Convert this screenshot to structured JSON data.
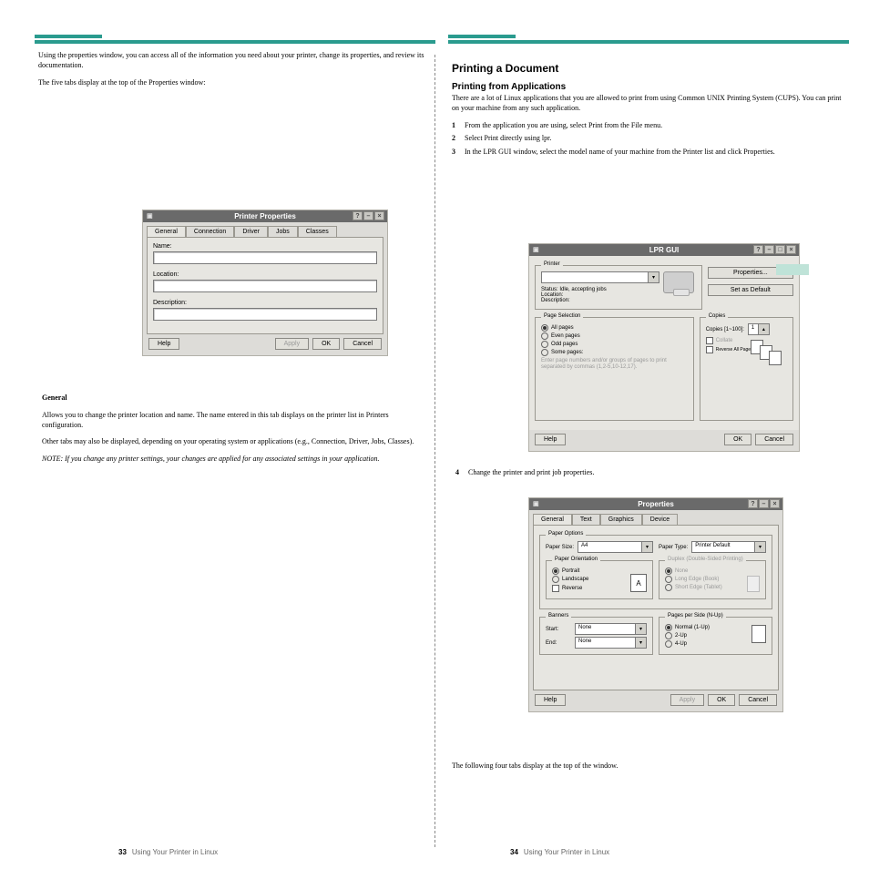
{
  "left_col": {
    "para1": "Using the properties window, you can access all of the information you need about your printer, change its properties, and review its documentation.",
    "para2": "The five tabs display at the top of the Properties window:",
    "sect_general": "General",
    "general_desc": "Allows you to change the printer location and name. The name entered in this tab displays on the printer list in Printers configuration.",
    "other_tabs": "Other tabs may also be displayed, depending on your operating system or applications (e.g., Connection, Driver, Jobs, Classes).",
    "note": "NOTE: If you change any printer settings, your changes are applied for any associated settings in your application."
  },
  "right_col": {
    "head": "Printing a Document",
    "subhead": "Printing from Applications",
    "intro": "There are a lot of Linux applications that you are allowed to print from using Common UNIX Printing System (CUPS). You can print on your machine from any such application.",
    "steps": {
      "s1": "From the application you are using, select Print from the File menu.",
      "s2": "Select Print directly using lpr.",
      "s3": "In the LPR GUI window, select the model name of your machine from the Printer list and click Properties."
    },
    "lpr_step": "Change the printer and print job properties.",
    "props_after": "The following four tabs display at the top of the window."
  },
  "dlg_printerprops": {
    "title": "Printer Properties",
    "tabs": [
      "General",
      "Connection",
      "Driver",
      "Jobs",
      "Classes"
    ],
    "labels": {
      "name": "Name:",
      "location": "Location:",
      "desc": "Description:"
    },
    "buttons": {
      "help": "Help",
      "apply": "Apply",
      "ok": "OK",
      "cancel": "Cancel"
    }
  },
  "dlg_lpr": {
    "title": "LPR GUI",
    "printer_group": "Printer",
    "status": "Status: Idle, accepting jobs",
    "location": "Location:",
    "description": "Description:",
    "props_btn": "Properties...",
    "setdef_btn": "Set as Default",
    "pagesel": "Page Selection",
    "allpages": "All pages",
    "even": "Even pages",
    "odd": "Odd pages",
    "some": "Some pages:",
    "hint": "Enter page numbers and/or groups of pages to print separated by commas (1,2-5,10-12,17).",
    "copies": "Copies",
    "copies_lbl": "Copies [1~100]:",
    "copies_value": "1",
    "collate": "Collate",
    "reverse": "Reverse All Pages (3,2,1)",
    "help": "Help",
    "ok": "OK",
    "cancel": "Cancel"
  },
  "dlg_props": {
    "title": "Properties",
    "tabs": [
      "General",
      "Text",
      "Graphics",
      "Device"
    ],
    "paperopts": "Paper Options",
    "papersize": "Paper Size:",
    "papersize_val": "A4",
    "papertype": "Paper Type:",
    "papertype_val": "Printer Default",
    "orient": "Paper Orientation",
    "portrait": "Portrait",
    "landscape": "Landscape",
    "rev": "Reverse",
    "duplex": "Duplex (Double-Sided Printing)",
    "dnone": "None",
    "dlong": "Long Edge (Book)",
    "dshort": "Short Edge (Tablet)",
    "banners": "Banners",
    "start": "Start:",
    "end": "End:",
    "none": "None",
    "pps": "Pages per Side (N-Up)",
    "n1": "Normal (1-Up)",
    "n2": "2-Up",
    "n4": "4-Up",
    "help": "Help",
    "apply": "Apply",
    "ok": "OK",
    "cancel": "Cancel"
  },
  "footer": {
    "left_num": "33",
    "right_num": "34",
    "label": "Using Your Printer in Linux"
  }
}
